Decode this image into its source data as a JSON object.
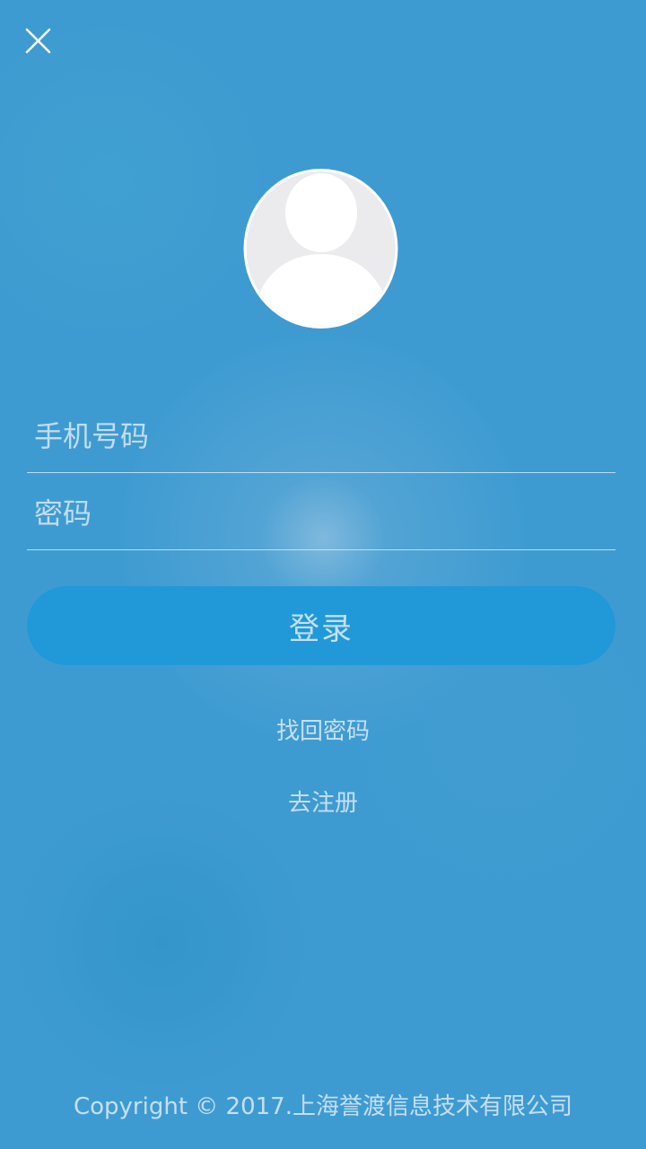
{
  "header": {
    "close_icon": "close-icon"
  },
  "avatar": {
    "icon": "user-avatar-icon"
  },
  "form": {
    "phone_placeholder": "手机号码",
    "password_placeholder": "密码",
    "login_label": "登录"
  },
  "links": {
    "forgot_password": "找回密码",
    "register": "去注册"
  },
  "footer": {
    "copyright": "Copyright © 2017.上海誉渡信息技术有限公司"
  },
  "colors": {
    "background": "#3e9bd1",
    "button": "#2199d8",
    "text_muted": "#d7e8f4"
  }
}
